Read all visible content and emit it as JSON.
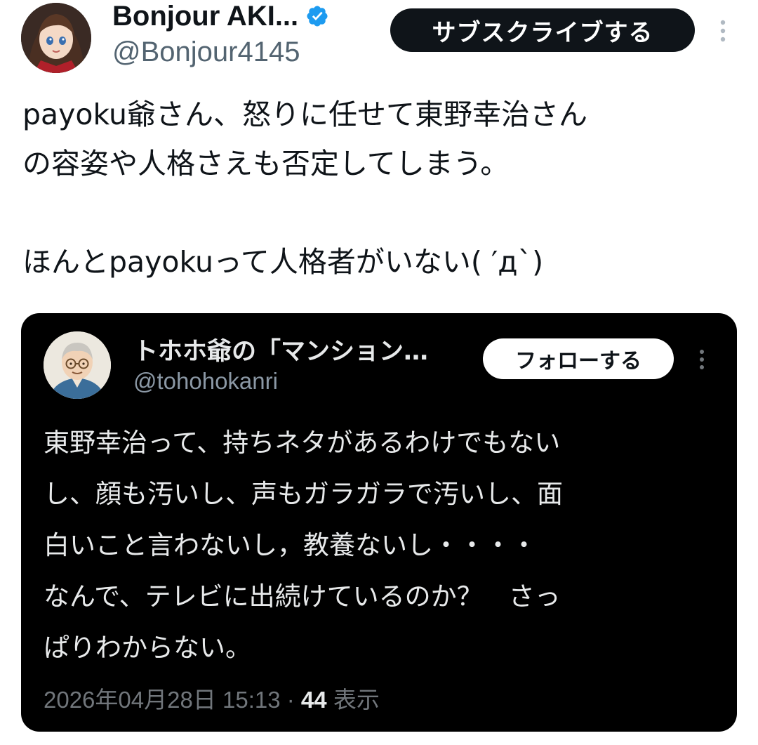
{
  "author": {
    "display_name": "Bonjour AKI...",
    "handle": "@Bonjour4145",
    "verified": true,
    "avatar_icon": "anime-girl-avatar-icon"
  },
  "actions": {
    "subscribe_label": "サブスクライブする",
    "more_icon": "more-vertical-icon"
  },
  "tweet": {
    "lines": [
      "payoku爺さん、怒りに任せて東野幸治さん",
      "の容姿や人格さえも否定してしまう。",
      "",
      "ほんとpayokuって人格者がいない( ′д`)"
    ]
  },
  "quoted": {
    "display_name": "トホホ爺の「マンション…",
    "handle": "@tohohokanri",
    "avatar_icon": "old-man-avatar-icon",
    "follow_label": "フォローする",
    "more_icon": "more-vertical-icon",
    "lines": [
      "東野幸治って、持ちネタがあるわけでもない",
      "し、顔も汚いし、声もガラガラで汚いし、面",
      "白いこと言わないし，教養ないし・・・・",
      "なんで、テレビに出続けているのか？　さっ",
      "ぱりわからない。"
    ],
    "timestamp": "2026年04月28日 15:13",
    "separator": "·",
    "views_count": "44",
    "views_label": "表示"
  },
  "colors": {
    "text_primary": "#0f1419",
    "text_secondary": "#536471",
    "verified_blue": "#1d9bf0",
    "card_background": "#000000",
    "card_text": "#e7e9ea",
    "card_meta": "#71767b"
  }
}
